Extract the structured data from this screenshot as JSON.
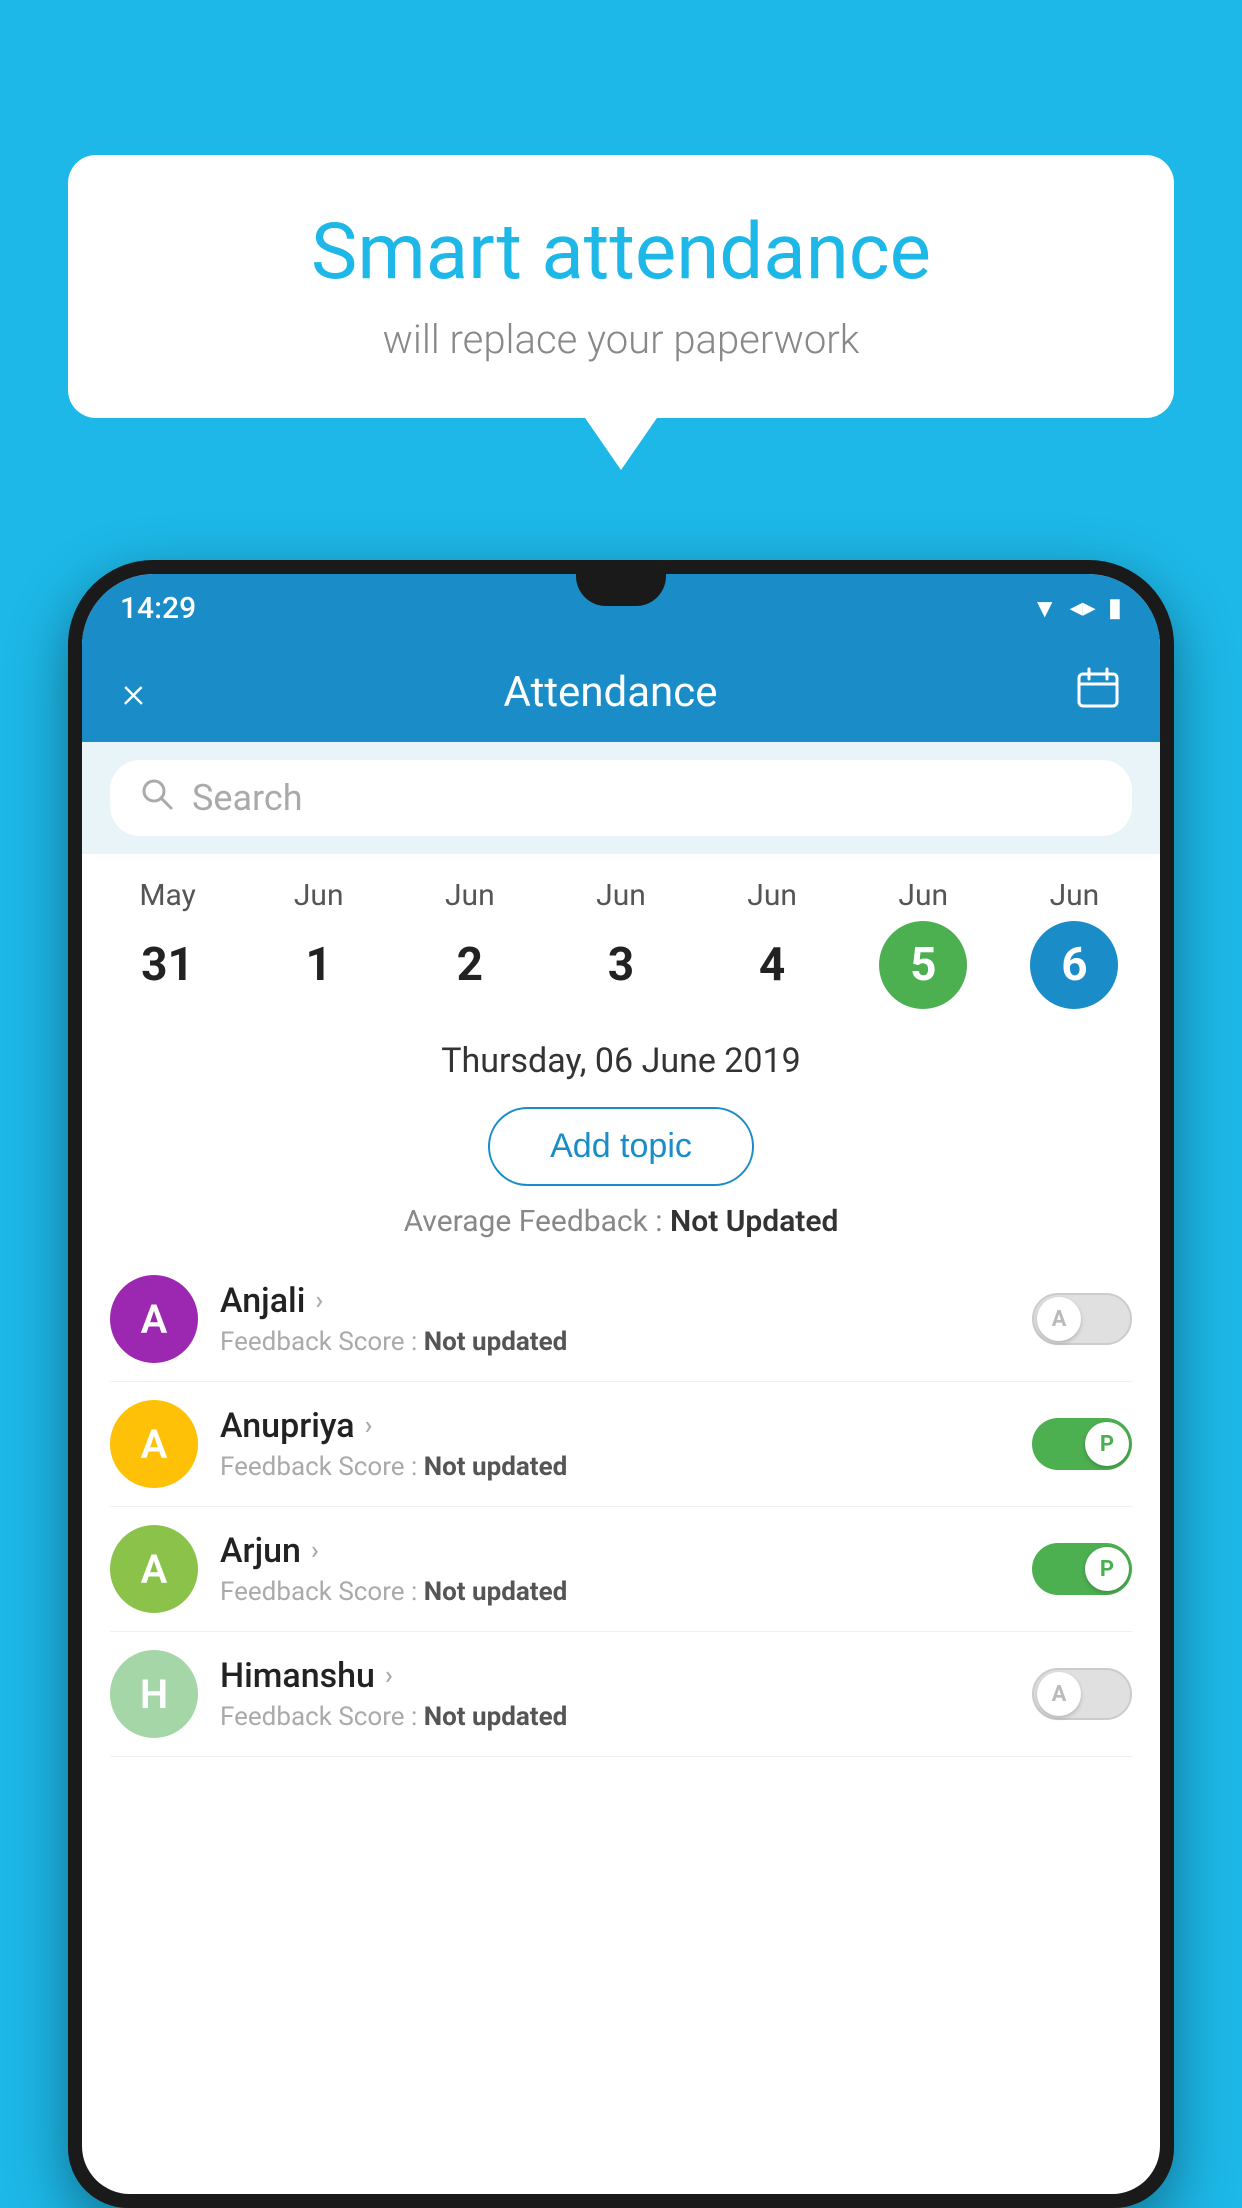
{
  "background_color": "#1DB8E8",
  "speech_bubble": {
    "title": "Smart attendance",
    "subtitle": "will replace your paperwork"
  },
  "status_bar": {
    "time": "14:29",
    "icons": [
      "wifi",
      "signal",
      "battery"
    ]
  },
  "app_header": {
    "title": "Attendance",
    "close_label": "×",
    "calendar_icon": "📅"
  },
  "search": {
    "placeholder": "Search"
  },
  "calendar": {
    "days": [
      {
        "month": "May",
        "date": "31",
        "state": "normal"
      },
      {
        "month": "Jun",
        "date": "1",
        "state": "normal"
      },
      {
        "month": "Jun",
        "date": "2",
        "state": "normal"
      },
      {
        "month": "Jun",
        "date": "3",
        "state": "normal"
      },
      {
        "month": "Jun",
        "date": "4",
        "state": "normal"
      },
      {
        "month": "Jun",
        "date": "5",
        "state": "today"
      },
      {
        "month": "Jun",
        "date": "6",
        "state": "selected"
      }
    ],
    "selected_date_label": "Thursday, 06 June 2019"
  },
  "add_topic_label": "Add topic",
  "average_feedback": {
    "label": "Average Feedback : ",
    "value": "Not Updated"
  },
  "students": [
    {
      "name": "Anjali",
      "avatar_letter": "A",
      "avatar_color": "#9C27B0",
      "feedback_label": "Feedback Score : ",
      "feedback_value": "Not updated",
      "toggle_state": "off",
      "toggle_letter": "A"
    },
    {
      "name": "Anupriya",
      "avatar_letter": "A",
      "avatar_color": "#FFC107",
      "feedback_label": "Feedback Score : ",
      "feedback_value": "Not updated",
      "toggle_state": "on",
      "toggle_letter": "P"
    },
    {
      "name": "Arjun",
      "avatar_letter": "A",
      "avatar_color": "#8BC34A",
      "feedback_label": "Feedback Score : ",
      "feedback_value": "Not updated",
      "toggle_state": "on",
      "toggle_letter": "P"
    },
    {
      "name": "Himanshu",
      "avatar_letter": "H",
      "avatar_color": "#A5D6A7",
      "feedback_label": "Feedback Score : ",
      "feedback_value": "Not updated",
      "toggle_state": "off",
      "toggle_letter": "A"
    }
  ]
}
